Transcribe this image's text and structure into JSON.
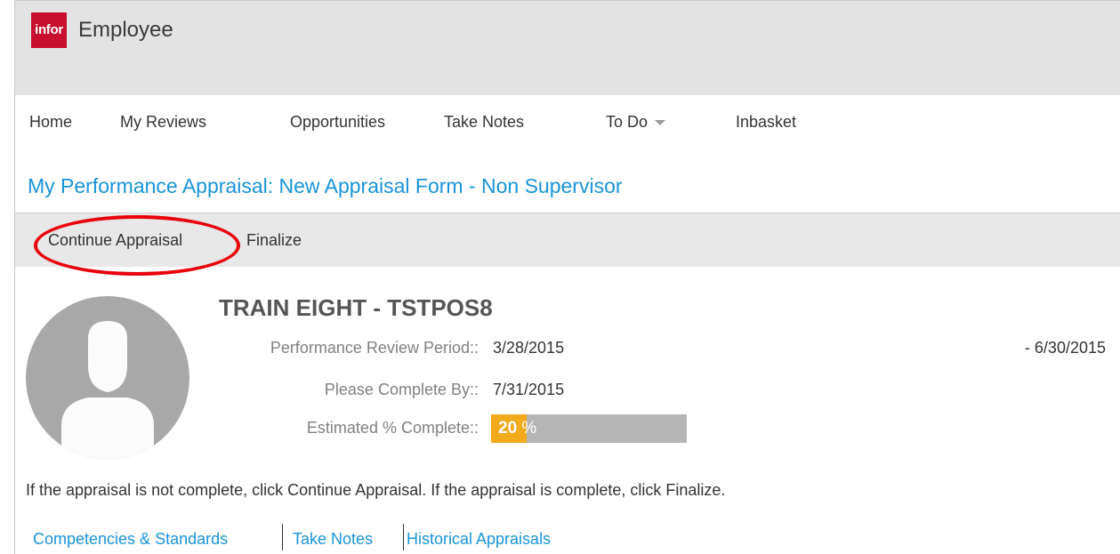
{
  "header": {
    "logo_text": "infor",
    "app_title": "Employee",
    "brand_color": "#c8102e"
  },
  "nav": {
    "items": [
      {
        "label": "Home"
      },
      {
        "label": "My Reviews"
      },
      {
        "label": "Opportunities"
      },
      {
        "label": "Take Notes"
      },
      {
        "label": "To Do",
        "icon": "chevron-down-icon"
      },
      {
        "label": "Inbasket"
      }
    ]
  },
  "page": {
    "title": "My Performance Appraisal: New Appraisal Form - Non Supervisor",
    "title_color": "#1a94d8"
  },
  "toolbar": {
    "continue_label": "Continue Appraisal",
    "finalize_label": "Finalize",
    "highlight_color": "#e8000b"
  },
  "employee": {
    "name": "TRAIN EIGHT - TSTPOS8",
    "avatar_icon": "user-avatar-icon",
    "review_period_label": "Performance Review Period::",
    "review_period_start": "3/28/2015",
    "review_period_end": "-  6/30/2015",
    "complete_by_label": "Please Complete By::",
    "complete_by_value": "7/31/2015",
    "estimated_label": "Estimated % Complete::",
    "estimated_value": "20",
    "estimated_unit": "%",
    "estimated_fraction": 0.2,
    "progress_color": "#f2a91b"
  },
  "instruction": "If the appraisal is not complete, click Continue Appraisal. If the appraisal is complete, click Finalize.",
  "tabs": [
    {
      "label": "Competencies & Standards"
    },
    {
      "label": "Take Notes"
    },
    {
      "label": "Historical Appraisals"
    }
  ]
}
